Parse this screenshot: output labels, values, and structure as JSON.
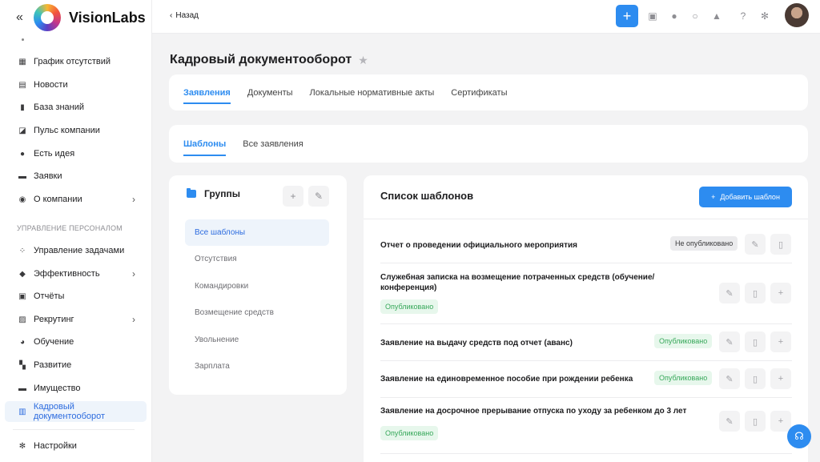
{
  "sidebar": {
    "brand": "VisionLabs",
    "items": [
      {
        "label": "График отсутствий",
        "icon": "calendar-icon"
      },
      {
        "label": "Новости",
        "icon": "news-icon"
      },
      {
        "label": "База знаний",
        "icon": "book-icon"
      },
      {
        "label": "Пульс компании",
        "icon": "chart-icon"
      },
      {
        "label": "Есть идея",
        "icon": "lightbulb-icon"
      },
      {
        "label": "Заявки",
        "icon": "inbox-icon"
      },
      {
        "label": "О компании",
        "icon": "info-icon"
      },
      {
        "label": "Управление задачами",
        "icon": "tasks-icon"
      },
      {
        "label": "Эффективность",
        "icon": "shield-icon"
      },
      {
        "label": "Отчёты",
        "icon": "report-icon"
      },
      {
        "label": "Рекрутинг",
        "icon": "id-card-icon"
      },
      {
        "label": "Обучение",
        "icon": "graduation-icon"
      },
      {
        "label": "Развитие",
        "icon": "grid-icon"
      },
      {
        "label": "Имущество",
        "icon": "box-icon"
      },
      {
        "label": "Кадровый документооборот",
        "icon": "document-icon"
      },
      {
        "label": "Настройки",
        "icon": "gear-icon"
      }
    ],
    "section_label": "УПРАВЛЕНИЕ ПЕРСОНАЛОМ"
  },
  "topbar": {
    "back_label": "Назад",
    "plus": "+"
  },
  "page": {
    "title": "Кадровый документооборот"
  },
  "tabs_main": [
    "Заявления",
    "Документы",
    "Локальные нормативные акты",
    "Сертификаты"
  ],
  "tabs_sub": [
    "Шаблоны",
    "Все заявления"
  ],
  "groups": {
    "title": "Группы",
    "items": [
      "Все шаблоны",
      "Отсутствия",
      "Командировки",
      "Возмещение средств",
      "Увольнение",
      "Зарплата"
    ]
  },
  "templates": {
    "title": "Список шаблонов",
    "add_label": "Добавить шаблон",
    "rows": [
      {
        "title": "Отчет о проведении официального мероприятия",
        "status": "Не опубликовано"
      },
      {
        "title": "Служебная записка на возмещение потраченных средств (обучение/ конференция)",
        "status": "Опубликовано"
      },
      {
        "title": "Заявление на выдачу средств под отчет (аванс)",
        "status": "Опубликовано"
      },
      {
        "title": "Заявление на единовременное пособие при рождении ребенка",
        "status": "Опубликовано"
      },
      {
        "title": "Заявление на досрочное прерывание отпуска по уходу за ребенком до 3 лет",
        "status": "Опубликовано"
      }
    ]
  },
  "colors": {
    "accent": "#2d8cf0",
    "published": "#37a85a"
  }
}
